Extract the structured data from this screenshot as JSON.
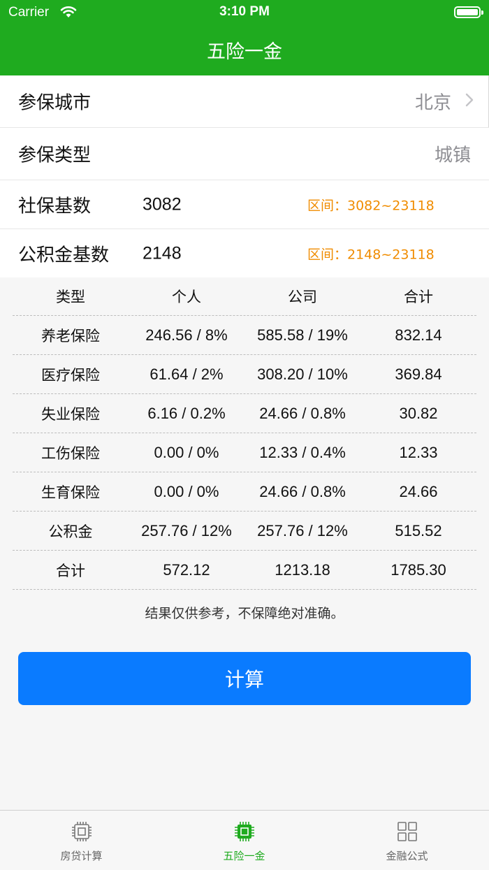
{
  "status_bar": {
    "carrier": "Carrier",
    "time": "3:10 PM",
    "battery_level": 1.0
  },
  "nav": {
    "title": "五险一金"
  },
  "form": {
    "city": {
      "label": "参保城市",
      "value": "北京"
    },
    "type": {
      "label": "参保类型",
      "value": "城镇"
    },
    "social_base": {
      "label": "社保基数",
      "value": "3082",
      "range": "区间：3082~23118"
    },
    "fund_base": {
      "label": "公积金基数",
      "value": "2148",
      "range": "区间：2148~23118"
    }
  },
  "table": {
    "headers": [
      "类型",
      "个人",
      "公司",
      "合计"
    ],
    "rows": [
      [
        "养老保险",
        "246.56 / 8%",
        "585.58 / 19%",
        "832.14"
      ],
      [
        "医疗保险",
        "61.64 / 2%",
        "308.20 / 10%",
        "369.84"
      ],
      [
        "失业保险",
        "6.16 / 0.2%",
        "24.66 / 0.8%",
        "30.82"
      ],
      [
        "工伤保险",
        "0.00 / 0%",
        "12.33 / 0.4%",
        "12.33"
      ],
      [
        "生育保险",
        "0.00 / 0%",
        "24.66 / 0.8%",
        "24.66"
      ],
      [
        "公积金",
        "257.76 / 12%",
        "257.76 / 12%",
        "515.52"
      ],
      [
        "合计",
        "572.12",
        "1213.18",
        "1785.30"
      ]
    ]
  },
  "note": "结果仅供参考，不保障绝对准确。",
  "calc_button": "计算",
  "tabs": [
    {
      "label": "房贷计算",
      "icon": "chip-icon",
      "active": false
    },
    {
      "label": "五险一金",
      "icon": "chip-icon",
      "active": true
    },
    {
      "label": "金融公式",
      "icon": "grid-icon",
      "active": false
    }
  ],
  "colors": {
    "brand_green": "#1fab1f",
    "button_blue": "#0a7bff",
    "range_orange": "#f08c00"
  }
}
